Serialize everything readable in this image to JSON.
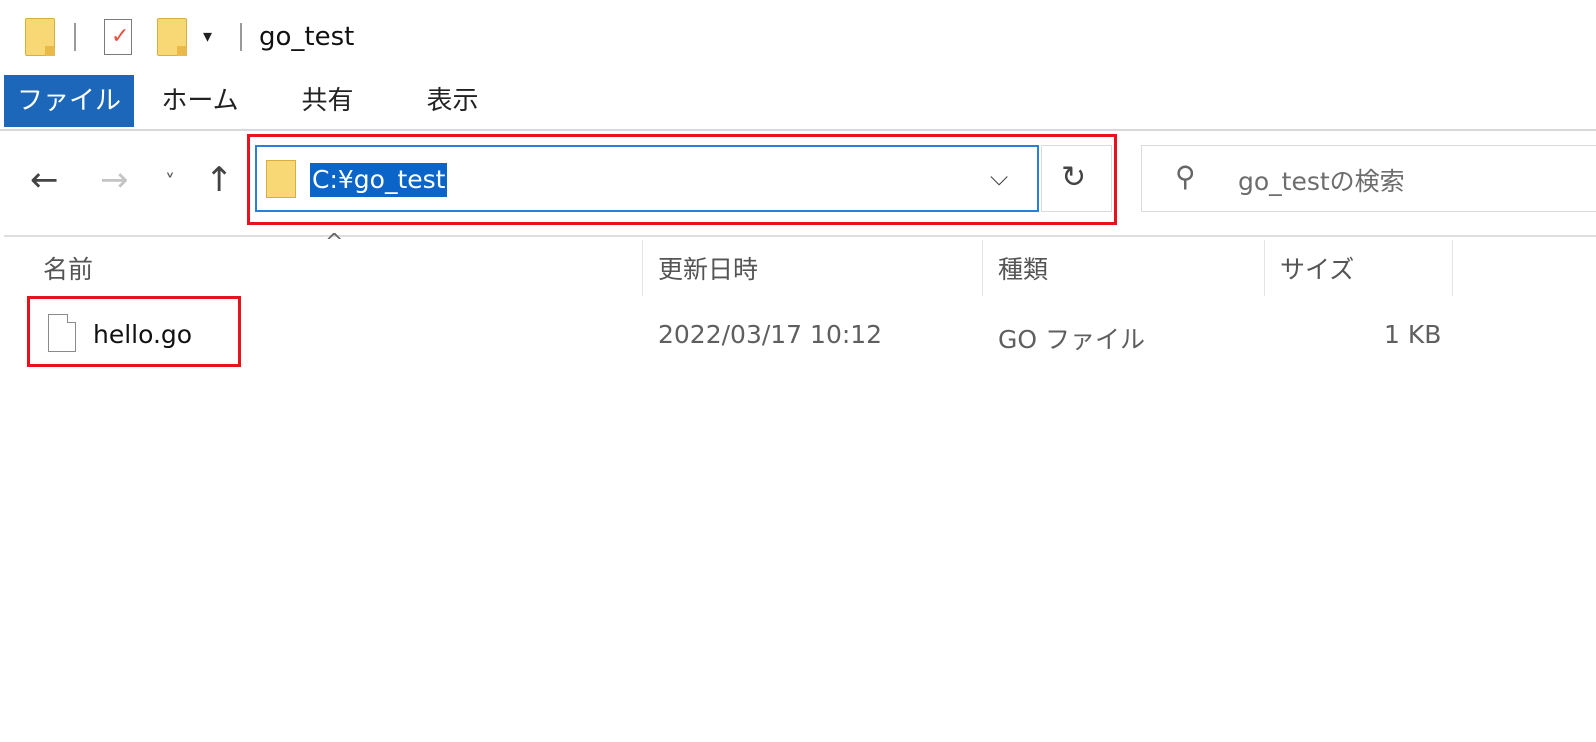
{
  "window": {
    "title": "go_test"
  },
  "quick_access": {
    "dropdown_glyph": "▾"
  },
  "ribbon": {
    "tabs": [
      {
        "label": "ファイル",
        "active": true
      },
      {
        "label": "ホーム"
      },
      {
        "label": "共有"
      },
      {
        "label": "表示"
      }
    ]
  },
  "navigation": {
    "back_icon": "←",
    "forward_icon": "→",
    "recent_icon": "˅",
    "up_icon": "↑"
  },
  "address_bar": {
    "path": "C:¥go_test",
    "chevron": "⌵",
    "refresh_icon": "↻"
  },
  "search": {
    "icon": "⚲",
    "placeholder": "go_testの検索"
  },
  "file_list": {
    "sort_indicator": "^",
    "columns": [
      "名前",
      "更新日時",
      "種類",
      "サイズ"
    ],
    "rows": [
      {
        "name": "hello.go",
        "modified": "2022/03/17 10:12",
        "type": "GO ファイル",
        "size": "1 KB"
      }
    ]
  },
  "colors": {
    "accent": "#1c67b9",
    "selection": "#0b64c8",
    "highlight_box": "#e8121d",
    "folder": "#f8d775"
  }
}
